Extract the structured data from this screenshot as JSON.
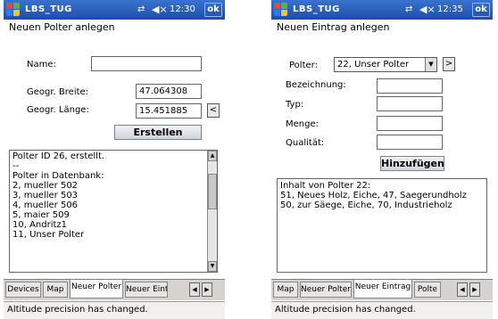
{
  "colors": {
    "titlebar": "#1d4ea8",
    "tab_bg": "#d6d3ce",
    "field_border": "#666666"
  },
  "left": {
    "titlebar": {
      "app": "LBS_TUG",
      "connection_icon": "connectivity-icon",
      "volume_icon": "speaker-icon",
      "time": "12:30",
      "ok": "ok"
    },
    "form_title": "Neuen Polter anlegen",
    "name_label": "Name:",
    "name_value": "",
    "lat_label": "Geogr. Breite:",
    "lat_value": "47.064308",
    "lon_label": "Geogr. Länge:",
    "lon_value": "15.451885",
    "back_button": "<",
    "create_button": "Erstellen",
    "log_lines": [
      "Polter ID 26,  erstellt.",
      "--",
      "Polter in Datenbank:",
      "2, mueller 502",
      "3, mueller 503",
      "4, mueller 506",
      "5, maier 509",
      "10, Andritz1",
      "11, Unser Polter"
    ],
    "tabs": [
      "Devices",
      "Map",
      "Neuer Polter",
      "Neuer Eint"
    ],
    "active_tab": 2,
    "status": "Altitude precision has changed."
  },
  "right": {
    "titlebar": {
      "app": "LBS_TUG",
      "connection_icon": "connectivity-icon",
      "volume_icon": "speaker-icon",
      "time": "12:35",
      "ok": "ok"
    },
    "form_title": "Neuen Eintrag anlegen",
    "polter_label": "Polter:",
    "polter_selected": "22, Unser Polter",
    "go_button": ">",
    "bezeichnung_label": "Bezeichnung:",
    "typ_label": "Typ:",
    "menge_label": "Menge:",
    "qualitaet_label": "Qualität:",
    "add_button": "Hinzufügen",
    "content_lines": [
      "Inhalt von Polter 22:",
      "51, Neues Holz, Eiche, 47, Saegerundholz",
      "50, zur Säege, Eiche, 70, Industrieholz"
    ],
    "tabs": [
      "Map",
      "Neuer Polter",
      "Neuer Eintrag",
      "Polte"
    ],
    "active_tab": 2,
    "status": "Altitude precision has changed."
  }
}
